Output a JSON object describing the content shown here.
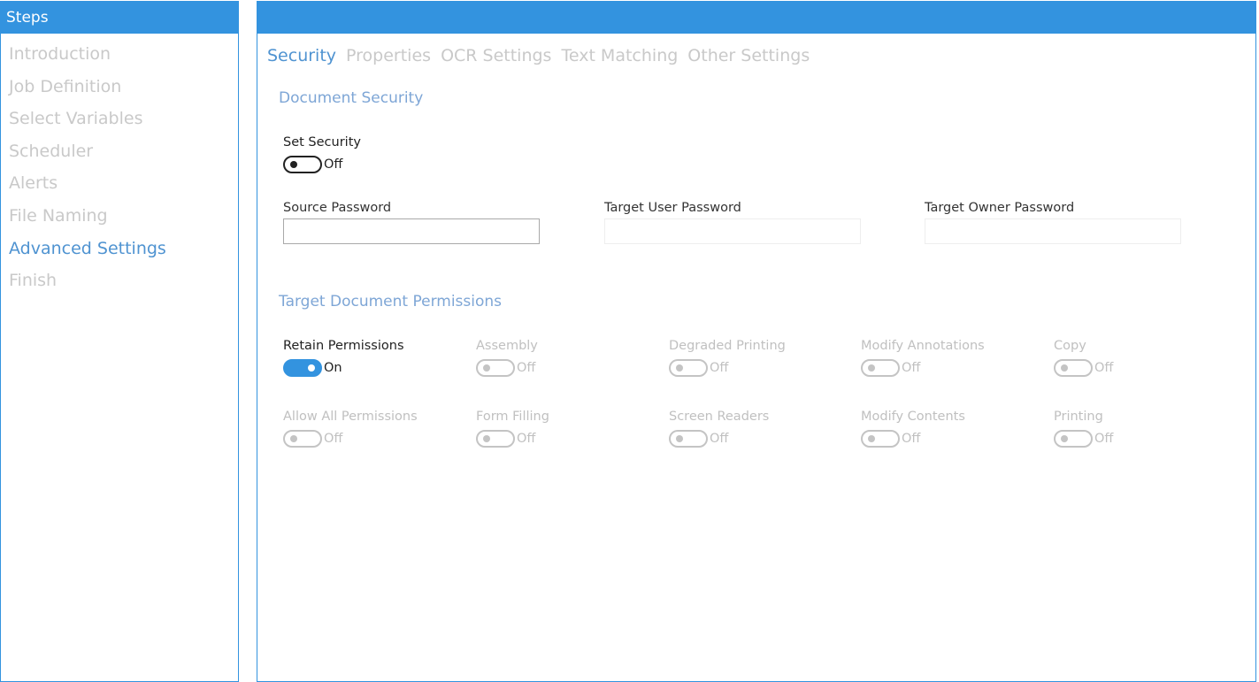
{
  "steps": {
    "title": "Steps",
    "items": [
      {
        "label": "Introduction",
        "active": false
      },
      {
        "label": "Job Definition",
        "active": false
      },
      {
        "label": "Select Variables",
        "active": false
      },
      {
        "label": "Scheduler",
        "active": false
      },
      {
        "label": "Alerts",
        "active": false
      },
      {
        "label": "File Naming",
        "active": false
      },
      {
        "label": "Advanced Settings",
        "active": true
      },
      {
        "label": "Finish",
        "active": false
      }
    ]
  },
  "tabs": [
    {
      "label": "Security",
      "active": true
    },
    {
      "label": "Properties",
      "active": false
    },
    {
      "label": "OCR Settings",
      "active": false
    },
    {
      "label": "Text Matching",
      "active": false
    },
    {
      "label": "Other Settings",
      "active": false
    }
  ],
  "document_security": {
    "title": "Document Security",
    "set_security": {
      "label": "Set Security",
      "state": "Off",
      "enabled": true
    },
    "source_password": {
      "label": "Source Password",
      "value": ""
    },
    "target_user_password": {
      "label": "Target User Password",
      "value": ""
    },
    "target_owner_password": {
      "label": "Target Owner Password",
      "value": ""
    }
  },
  "permissions": {
    "title": "Target Document Permissions",
    "toggles": [
      {
        "label": "Retain Permissions",
        "state": "On",
        "enabled": true
      },
      {
        "label": "Assembly",
        "state": "Off",
        "enabled": false
      },
      {
        "label": "Degraded Printing",
        "state": "Off",
        "enabled": false
      },
      {
        "label": "Modify Annotations",
        "state": "Off",
        "enabled": false
      },
      {
        "label": "Copy",
        "state": "Off",
        "enabled": false
      },
      {
        "label": "Allow All Permissions",
        "state": "Off",
        "enabled": false
      },
      {
        "label": "Form Filling",
        "state": "Off",
        "enabled": false
      },
      {
        "label": "Screen Readers",
        "state": "Off",
        "enabled": false
      },
      {
        "label": "Modify Contents",
        "state": "Off",
        "enabled": false
      },
      {
        "label": "Printing",
        "state": "Off",
        "enabled": false
      }
    ]
  },
  "colors": {
    "accent": "#3393df",
    "active_text": "#4f93d1",
    "section_title": "#7ea6d6",
    "disabled_text": "#c9c9c9"
  }
}
